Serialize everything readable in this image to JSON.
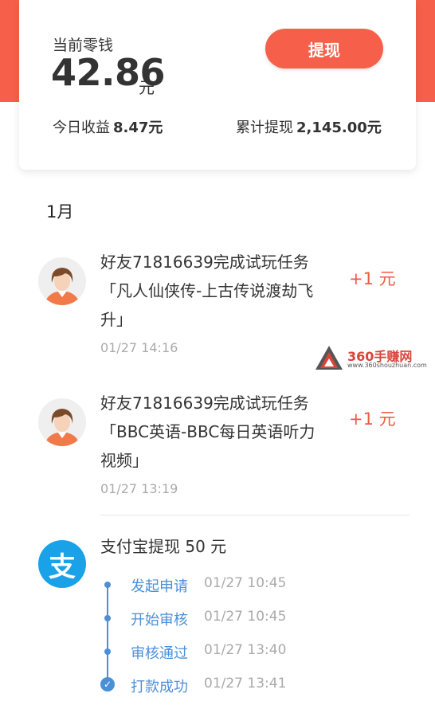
{
  "balance": {
    "label": "当前零钱",
    "amount": "42.86",
    "unit": "元",
    "withdraw_label": "提现",
    "today_label": "今日收益",
    "today_value": "8.47元",
    "total_label": "累计提现",
    "total_value": "2,145.00元"
  },
  "month": "1月",
  "entries": [
    {
      "text": "好友71816639完成试玩任务「凡人仙侠传-上古传说渡劫飞升」",
      "time": "01/27 14:16",
      "reward": "+1 元"
    },
    {
      "text": "好友71816639完成试玩任务「BBC英语-BBC每日英语听力视频」",
      "time": "01/27 13:19",
      "reward": "+1 元"
    }
  ],
  "withdrawal": {
    "icon_char": "支",
    "title": "支付宝提现 50 元",
    "steps": [
      {
        "label": "发起申请",
        "time": "01/27 10:45"
      },
      {
        "label": "开始审核",
        "time": "01/27 10:45"
      },
      {
        "label": "审核通过",
        "time": "01/27 13:40"
      },
      {
        "label": "打款成功",
        "time": "01/27 13:41"
      }
    ]
  },
  "watermark": {
    "brand": "360手赚网",
    "url": "www.360shouzhuan.com"
  },
  "colors": {
    "accent": "#f6604a",
    "reward": "#ef5a46",
    "timeline": "#4a90d9",
    "alipay": "#1aa2e8"
  }
}
